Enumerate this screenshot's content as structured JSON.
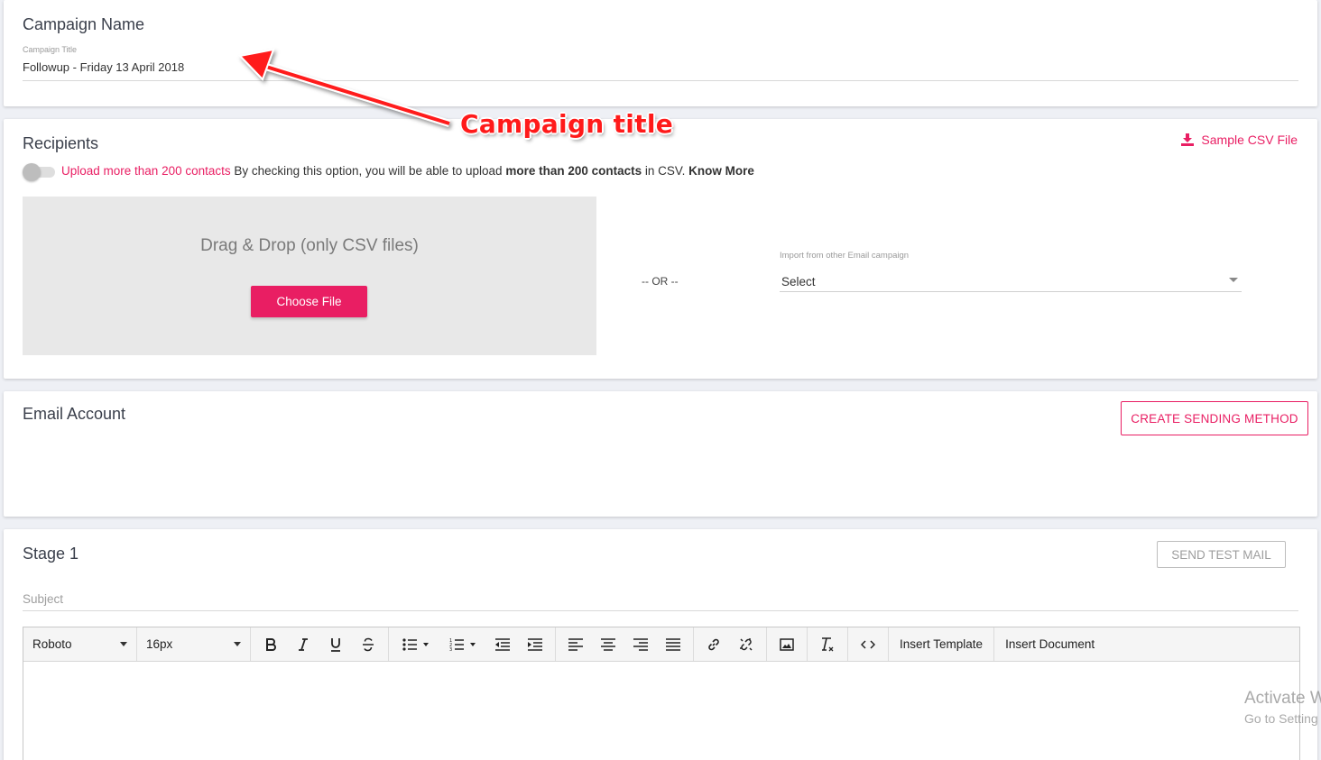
{
  "campaign_name": {
    "title": "Campaign Name",
    "field_label": "Campaign Title",
    "field_value": "Followup - Friday 13 April 2018"
  },
  "annotation": {
    "text": "Campaign title",
    "color": "#ff1a1a"
  },
  "recipients": {
    "title": "Recipients",
    "sample_csv": "Sample CSV File",
    "toggle_label": "Upload more than 200 contacts",
    "toggle_desc_1": " By checking this option, you will be able to upload ",
    "toggle_desc_bold": "more than 200 contacts",
    "toggle_desc_2": " in CSV. ",
    "know_more": "Know More",
    "dropzone_text": "Drag & Drop (only CSV files)",
    "choose_file": "Choose File",
    "or_text": "-- OR --",
    "import_label": "Import from other Email campaign",
    "import_value": "Select"
  },
  "email_account": {
    "title": "Email Account",
    "create_button": "CREATE SENDING METHOD"
  },
  "stage": {
    "title": "Stage 1",
    "send_test": "SEND TEST MAIL",
    "subject_placeholder": "Subject",
    "toolbar": {
      "font": "Roboto",
      "size": "16px",
      "insert_template": "Insert Template",
      "insert_document": "Insert Document"
    }
  },
  "watermark": {
    "line1": "Activate W",
    "line2": "Go to Setting"
  },
  "colors": {
    "accent": "#e91e63",
    "background": "#eef0f5"
  }
}
